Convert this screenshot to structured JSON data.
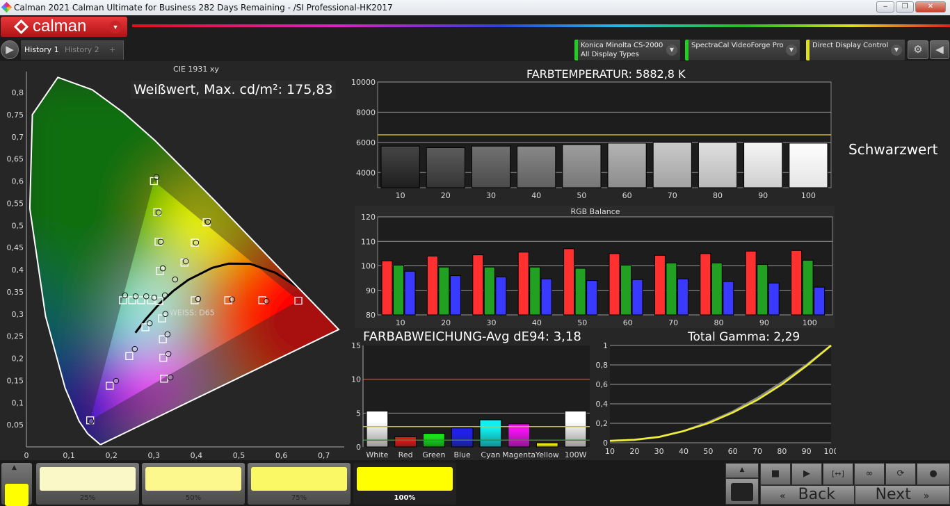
{
  "window": {
    "title": "Calman 2021 Calman Ultimate for Business 282 Days Remaining  - /SI Professional-HK2017",
    "minimize": "‒",
    "restore": "❐",
    "close": "✕"
  },
  "header": {
    "logo": "calman"
  },
  "tabs": [
    {
      "label": "History 1",
      "active": true
    },
    {
      "label": "History 2",
      "active": false
    }
  ],
  "add_tab": "+",
  "sources": [
    {
      "line1": "Konica Minolta CS-2000",
      "line2": "All Display Types",
      "color": "#22cc22"
    },
    {
      "line1": "SpectraCal VideoForge Pro",
      "line2": "",
      "color": "#22cc22"
    },
    {
      "line1": "Direct Display Control",
      "line2": "",
      "color": "#dddd22"
    }
  ],
  "icons": {
    "settings": "gear-icon",
    "collapse": "chevron-left-icon",
    "expand": "chevron-right-icon"
  },
  "white_overlay": "Weißwert, Max. cd/m²: 175,83",
  "black_label": "Schwarzwert",
  "chart_data": [
    {
      "type": "scatter",
      "title": "CIE 1931 xy",
      "xlim": [
        0,
        0.75
      ],
      "ylim": [
        0,
        0.85
      ],
      "xticks": [
        "0",
        "0,1",
        "0,2",
        "0,3",
        "0,4",
        "0,5",
        "0,6",
        "0,7"
      ],
      "yticks": [
        "0,05",
        "0,1",
        "0,15",
        "0,2",
        "0,25",
        "0,3",
        "0,35",
        "0,4",
        "0,45",
        "0,5",
        "0,55",
        "0,6",
        "0,65",
        "0,7",
        "0,75",
        "0,8"
      ],
      "white_label": "WEISS: D65",
      "gamut": [
        [
          0.64,
          0.33
        ],
        [
          0.3,
          0.6
        ],
        [
          0.15,
          0.06
        ]
      ],
      "targets": [
        [
          0.64,
          0.33
        ],
        [
          0.555,
          0.331
        ],
        [
          0.475,
          0.331
        ],
        [
          0.396,
          0.331
        ],
        [
          0.3,
          0.6
        ],
        [
          0.308,
          0.53
        ],
        [
          0.311,
          0.463
        ],
        [
          0.314,
          0.397
        ],
        [
          0.15,
          0.06
        ],
        [
          0.196,
          0.138
        ],
        [
          0.242,
          0.205
        ],
        [
          0.28,
          0.27
        ],
        [
          0.227,
          0.331
        ],
        [
          0.249,
          0.331
        ],
        [
          0.27,
          0.331
        ],
        [
          0.293,
          0.331
        ],
        [
          0.324,
          0.154
        ],
        [
          0.322,
          0.201
        ],
        [
          0.321,
          0.243
        ],
        [
          0.319,
          0.29
        ],
        [
          0.424,
          0.507
        ],
        [
          0.396,
          0.461
        ],
        [
          0.372,
          0.416
        ],
        [
          0.3127,
          0.329
        ]
      ],
      "measured": [
        [
          0.565,
          0.329
        ],
        [
          0.484,
          0.333
        ],
        [
          0.404,
          0.334
        ],
        [
          0.306,
          0.609
        ],
        [
          0.311,
          0.529
        ],
        [
          0.316,
          0.463
        ],
        [
          0.321,
          0.403
        ],
        [
          0.152,
          0.058
        ],
        [
          0.211,
          0.149
        ],
        [
          0.255,
          0.221
        ],
        [
          0.29,
          0.279
        ],
        [
          0.232,
          0.342
        ],
        [
          0.257,
          0.34
        ],
        [
          0.282,
          0.34
        ],
        [
          0.301,
          0.337
        ],
        [
          0.339,
          0.157
        ],
        [
          0.334,
          0.21
        ],
        [
          0.332,
          0.254
        ],
        [
          0.327,
          0.3
        ],
        [
          0.427,
          0.508
        ],
        [
          0.399,
          0.461
        ],
        [
          0.375,
          0.419
        ],
        [
          0.35,
          0.378
        ],
        [
          0.326,
          0.342
        ]
      ]
    },
    {
      "type": "bar",
      "title": "FARBTEMPERATUR: 5882,8 K",
      "categories": [
        "10",
        "20",
        "30",
        "40",
        "50",
        "60",
        "70",
        "80",
        "90",
        "100"
      ],
      "values": [
        5750,
        5650,
        5750,
        5750,
        5850,
        5950,
        6000,
        6000,
        6000,
        5950
      ],
      "target": 6500,
      "target_color": "#d4b21c",
      "ylim": [
        3000,
        10000
      ],
      "yticks": [
        "4000",
        "6000",
        "8000",
        "10000"
      ]
    },
    {
      "type": "bar",
      "title": "RGB Balance",
      "categories": [
        "10",
        "20",
        "30",
        "40",
        "50",
        "60",
        "70",
        "80",
        "90",
        "100"
      ],
      "series": [
        {
          "color": "#ff3030",
          "values": [
            102,
            104,
            104.5,
            105.6,
            107,
            105,
            104.3,
            105,
            106,
            106.3
          ]
        },
        {
          "color": "#22a022",
          "values": [
            100.3,
            99.5,
            99.5,
            99.5,
            99,
            100.3,
            101.2,
            101.2,
            100.6,
            102.3
          ]
        },
        {
          "color": "#3a3aff",
          "values": [
            97.8,
            96,
            95.5,
            94.7,
            94,
            94.4,
            94.7,
            93.6,
            93,
            91.3
          ]
        }
      ],
      "ylim": [
        80,
        120
      ],
      "yticks": [
        "80",
        "90",
        "100",
        "110",
        "120"
      ]
    },
    {
      "type": "bar",
      "title": "FARBABWEICHUNG-Avg dE94: 3,18",
      "categories": [
        "White",
        "Red",
        "Green",
        "Blue",
        "Cyan",
        "Magenta",
        "Yellow",
        "100W"
      ],
      "values": [
        5.3,
        1.5,
        2.0,
        2.8,
        4.0,
        3.4,
        0.6,
        5.3
      ],
      "colors": [
        "#ffffff",
        "#e01818",
        "#18e018",
        "#2020e8",
        "#10f0f0",
        "#f010f0",
        "#f0f010",
        "#ffffff"
      ],
      "thresholds": [
        {
          "value": 10,
          "color": "#c83a3a"
        },
        {
          "value": 3,
          "color": "#c8c030"
        },
        {
          "value": 1,
          "color": "#3a8a3a"
        }
      ],
      "ylim": [
        0,
        15
      ],
      "yticks": [
        "0",
        "5",
        "10",
        "15"
      ]
    },
    {
      "type": "line",
      "title": "Total Gamma: 2,29",
      "x": [
        10,
        20,
        30,
        40,
        50,
        60,
        70,
        80,
        90,
        100
      ],
      "series": [
        {
          "color": "#f0f030",
          "values": [
            0.02,
            0.03,
            0.06,
            0.12,
            0.2,
            0.31,
            0.44,
            0.6,
            0.79,
            1.0
          ]
        },
        {
          "color": "#888888",
          "values": [
            0.02,
            0.03,
            0.06,
            0.12,
            0.21,
            0.32,
            0.46,
            0.62,
            0.8,
            1.0
          ]
        }
      ],
      "xlim": [
        10,
        100
      ],
      "ylim": [
        0,
        1
      ],
      "xticks": [
        "10",
        "20",
        "30",
        "40",
        "50",
        "60",
        "70",
        "80",
        "90",
        "100"
      ],
      "yticks": [
        "0",
        "0,2",
        "0,4",
        "0,6",
        "0,8",
        "1"
      ]
    }
  ],
  "bottom": {
    "current_color": "#ffff00",
    "patches": [
      {
        "label": "25%",
        "color": "#fbf8c8"
      },
      {
        "label": "50%",
        "color": "#fcf88e"
      },
      {
        "label": "75%",
        "color": "#fbf865"
      },
      {
        "label": "100%",
        "color": "#ffff00",
        "active": true
      }
    ],
    "controls": [
      "stop-icon",
      "play-icon",
      "fit-icon",
      "loop-icon",
      "refresh-icon",
      "circle-icon"
    ],
    "back": "Back",
    "next": "Next",
    "back_icon": "«",
    "next_icon": "»"
  }
}
